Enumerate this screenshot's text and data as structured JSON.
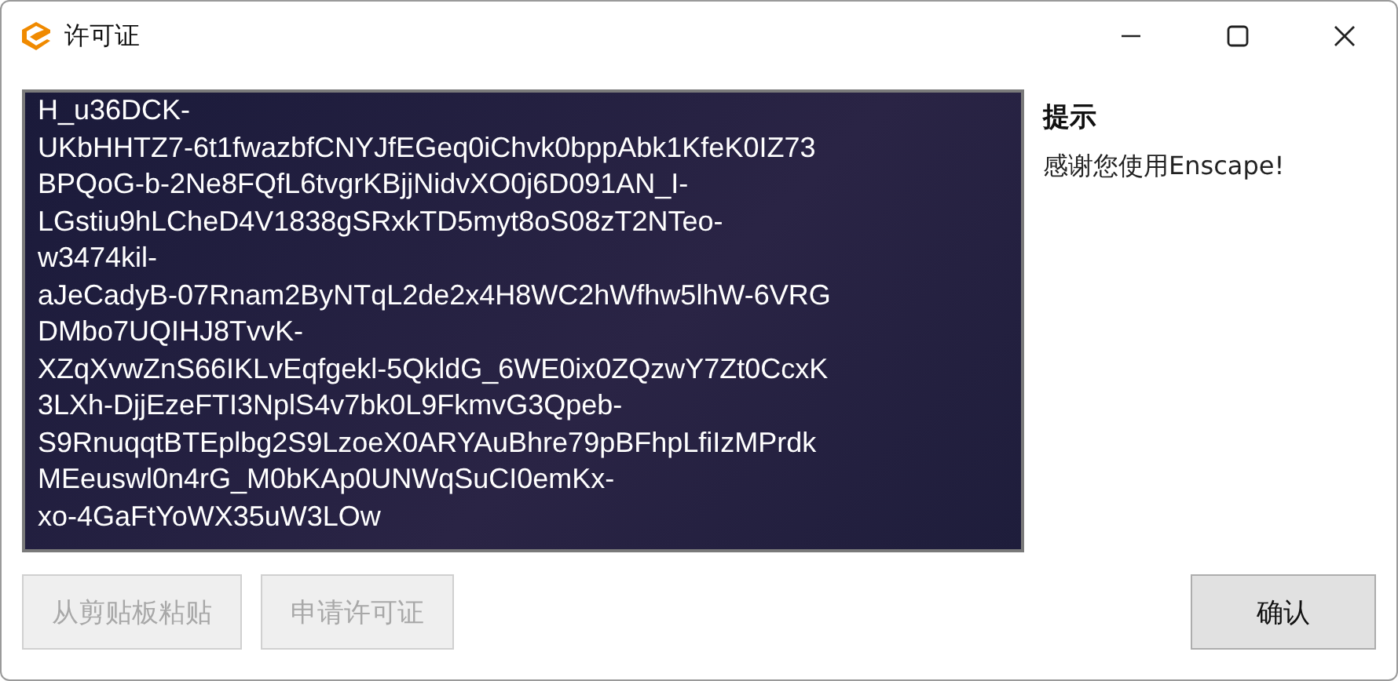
{
  "window": {
    "title": "许可证"
  },
  "license_field": {
    "lines": [
      "H_u36DCK-",
      "UKbHHTZ7-6t1fwazbfCNYJfEGeq0iChvk0bppAbk1KfeK0IZ73",
      "BPQoG-b-2Ne8FQfL6tvgrKBjjNidvXO0j6D091AN_I-",
      "LGstiu9hLCheD4V1838gSRxkTD5myt8oS08zT2NTeo-",
      "w3474kil-",
      "aJeCadyB-07Rnam2ByNTqL2de2x4H8WC2hWfhw5lhW-6VRG",
      "DMbo7UQIHJ8TvvK-",
      "XZqXvwZnS66IKLvEqfgekl-5QkldG_6WE0ix0ZQzwY7Zt0CcxK",
      "3LXh-DjjEzeFTI3NplS4v7bk0L9FkmvG3Qpeb-",
      "S9RnuqqtBTEplbg2S9LzoeX0ARYAuBhre79pBFhpLfiIzMPrdk",
      "MEeuswl0n4rG_M0bKAp0UNWqSuCI0emKx-",
      "xo-4GaFtYoWX35uW3LOw"
    ]
  },
  "hint": {
    "title": "提示",
    "message": "感谢您使用Enscape!"
  },
  "buttons": [
    {
      "label": "从剪贴板粘贴",
      "disabled": true
    },
    {
      "label": "申请许可证",
      "disabled": true
    },
    {
      "label": "确认",
      "disabled": false
    }
  ]
}
